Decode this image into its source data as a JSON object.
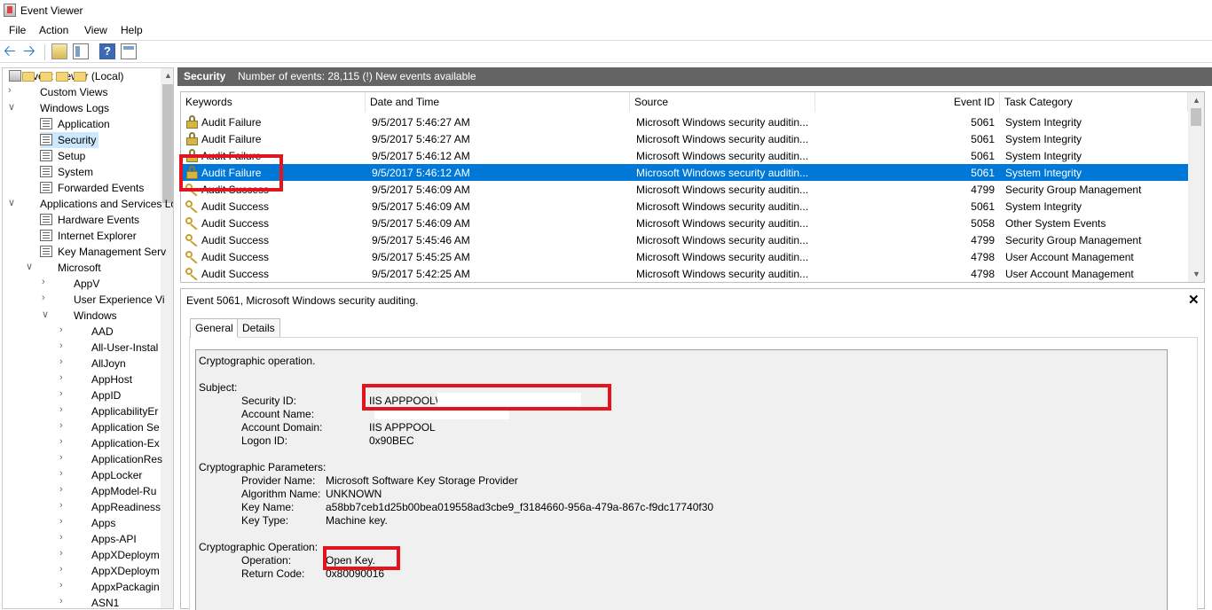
{
  "window": {
    "title": "Event Viewer"
  },
  "menu": [
    "File",
    "Action",
    "View",
    "Help"
  ],
  "tree": {
    "root": "Event Viewer (Local)",
    "items": [
      {
        "label": "Custom Views",
        "level": 1,
        "icon": "folder",
        "exp": ">"
      },
      {
        "label": "Windows Logs",
        "level": 1,
        "icon": "folder",
        "exp": "v"
      },
      {
        "label": "Application",
        "level": 2,
        "icon": "log"
      },
      {
        "label": "Security",
        "level": 2,
        "icon": "log",
        "selected": true
      },
      {
        "label": "Setup",
        "level": 2,
        "icon": "log"
      },
      {
        "label": "System",
        "level": 2,
        "icon": "log"
      },
      {
        "label": "Forwarded Events",
        "level": 2,
        "icon": "log"
      },
      {
        "label": "Applications and Services Lo",
        "level": 1,
        "icon": "folder",
        "exp": "v"
      },
      {
        "label": "Hardware Events",
        "level": 2,
        "icon": "log"
      },
      {
        "label": "Internet Explorer",
        "level": 2,
        "icon": "log"
      },
      {
        "label": "Key Management Serv",
        "level": 2,
        "icon": "log"
      },
      {
        "label": "Microsoft",
        "level": 2,
        "icon": "folder",
        "exp": "v"
      },
      {
        "label": "AppV",
        "level": 3,
        "icon": "folder",
        "exp": ">"
      },
      {
        "label": "User Experience Vi",
        "level": 3,
        "icon": "folder",
        "exp": ">"
      },
      {
        "label": "Windows",
        "level": 3,
        "icon": "folder",
        "exp": "v"
      },
      {
        "label": "AAD",
        "level": 4,
        "icon": "folder",
        "exp": ">"
      },
      {
        "label": "All-User-Instal",
        "level": 4,
        "icon": "folder",
        "exp": ">"
      },
      {
        "label": "AllJoyn",
        "level": 4,
        "icon": "folder",
        "exp": ">"
      },
      {
        "label": "AppHost",
        "level": 4,
        "icon": "folder",
        "exp": ">"
      },
      {
        "label": "AppID",
        "level": 4,
        "icon": "folder",
        "exp": ">"
      },
      {
        "label": "ApplicabilityEr",
        "level": 4,
        "icon": "folder",
        "exp": ">"
      },
      {
        "label": "Application Se",
        "level": 4,
        "icon": "folder",
        "exp": ">"
      },
      {
        "label": "Application-Ex",
        "level": 4,
        "icon": "folder",
        "exp": ">"
      },
      {
        "label": "ApplicationRes",
        "level": 4,
        "icon": "folder",
        "exp": ">"
      },
      {
        "label": "AppLocker",
        "level": 4,
        "icon": "folder",
        "exp": ">"
      },
      {
        "label": "AppModel-Ru",
        "level": 4,
        "icon": "folder",
        "exp": ">"
      },
      {
        "label": "AppReadiness",
        "level": 4,
        "icon": "folder",
        "exp": ">"
      },
      {
        "label": "Apps",
        "level": 4,
        "icon": "folder",
        "exp": ">"
      },
      {
        "label": "Apps-API",
        "level": 4,
        "icon": "folder",
        "exp": ">"
      },
      {
        "label": "AppXDeploym",
        "level": 4,
        "icon": "folder",
        "exp": ">"
      },
      {
        "label": "AppXDeploym",
        "level": 4,
        "icon": "folder",
        "exp": ">"
      },
      {
        "label": "AppxPackagin",
        "level": 4,
        "icon": "folder",
        "exp": ">"
      },
      {
        "label": "ASN1",
        "level": 4,
        "icon": "folder",
        "exp": ">"
      }
    ]
  },
  "header": {
    "log": "Security",
    "info": "Number of events: 28,115 (!) New events available"
  },
  "columns": [
    "Keywords",
    "Date and Time",
    "Source",
    "Event ID",
    "Task Category"
  ],
  "events": [
    {
      "icon": "lock",
      "keywords": "Audit Failure",
      "date": "9/5/2017 5:46:27 AM",
      "source": "Microsoft Windows security auditin...",
      "id": "5061",
      "task": "System Integrity"
    },
    {
      "icon": "lock",
      "keywords": "Audit Failure",
      "date": "9/5/2017 5:46:27 AM",
      "source": "Microsoft Windows security auditin...",
      "id": "5061",
      "task": "System Integrity"
    },
    {
      "icon": "lock",
      "keywords": "Audit Failure",
      "date": "9/5/2017 5:46:12 AM",
      "source": "Microsoft Windows security auditin...",
      "id": "5061",
      "task": "System Integrity"
    },
    {
      "icon": "lock",
      "keywords": "Audit Failure",
      "date": "9/5/2017 5:46:12 AM",
      "source": "Microsoft Windows security auditin...",
      "id": "5061",
      "task": "System Integrity",
      "selected": true
    },
    {
      "icon": "key",
      "keywords": "Audit Success",
      "date": "9/5/2017 5:46:09 AM",
      "source": "Microsoft Windows security auditin...",
      "id": "4799",
      "task": "Security Group Management"
    },
    {
      "icon": "key",
      "keywords": "Audit Success",
      "date": "9/5/2017 5:46:09 AM",
      "source": "Microsoft Windows security auditin...",
      "id": "5061",
      "task": "System Integrity"
    },
    {
      "icon": "key",
      "keywords": "Audit Success",
      "date": "9/5/2017 5:46:09 AM",
      "source": "Microsoft Windows security auditin...",
      "id": "5058",
      "task": "Other System Events"
    },
    {
      "icon": "key",
      "keywords": "Audit Success",
      "date": "9/5/2017 5:45:46 AM",
      "source": "Microsoft Windows security auditin...",
      "id": "4799",
      "task": "Security Group Management"
    },
    {
      "icon": "key",
      "keywords": "Audit Success",
      "date": "9/5/2017 5:45:25 AM",
      "source": "Microsoft Windows security auditin...",
      "id": "4798",
      "task": "User Account Management"
    },
    {
      "icon": "key",
      "keywords": "Audit Success",
      "date": "9/5/2017 5:42:25 AM",
      "source": "Microsoft Windows security auditin...",
      "id": "4798",
      "task": "User Account Management"
    }
  ],
  "details": {
    "title": "Event 5061, Microsoft Windows security auditing.",
    "tabs": [
      "General",
      "Details"
    ],
    "lines": [
      {
        "text": "Cryptographic operation.",
        "indent": 0
      },
      {
        "text": "Subject:",
        "indent": 0
      },
      {
        "label": "Security ID:",
        "value": "IIS APPPOOL\\"
      },
      {
        "label": "Account Name:",
        "value": ""
      },
      {
        "label": "Account Domain:",
        "value": "IIS APPPOOL"
      },
      {
        "label": "Logon ID:",
        "value": "0x90BEC"
      },
      {
        "text": "Cryptographic Parameters:",
        "indent": 0
      },
      {
        "label": "Provider Name:",
        "value": "Microsoft Software Key Storage Provider"
      },
      {
        "label": "Algorithm Name:",
        "value": "UNKNOWN"
      },
      {
        "label": "Key Name:",
        "value": "a58bb7ceb1d25b00bea019558ad3cbe9_f3184660-956a-479a-867c-f9dc17740f30"
      },
      {
        "label": "Key Type:",
        "value": "Machine key."
      },
      {
        "text": "Cryptographic Operation:",
        "indent": 0
      },
      {
        "label": "Operation:",
        "value": "Open Key."
      },
      {
        "label": "Return Code:",
        "value": "0x80090016"
      }
    ]
  },
  "colors": {
    "selection": "#0078d7",
    "header": "#646464",
    "highlight": "#e3141e"
  }
}
